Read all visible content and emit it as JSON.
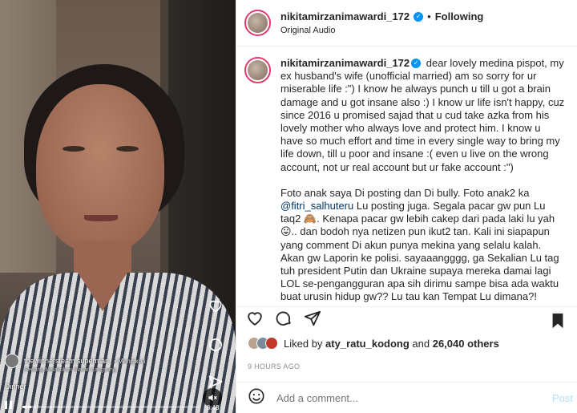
{
  "video": {
    "live_user": "thewinnersteam.superman",
    "live_follow": "• Mengikuti",
    "live_sub": "Sedang Melakukan Siaran Langsung",
    "caption": "Dinner",
    "timecode": "0:43",
    "progress_fraction": 0.05,
    "icons": [
      "heart-icon",
      "comment-icon",
      "share-icon",
      "mute-icon",
      "pause-icon"
    ]
  },
  "header": {
    "username": "nikitamirzanimawardi_172",
    "separator": "•",
    "follow_label": "Following",
    "subtitle": "Original Audio"
  },
  "caption": {
    "username": "nikitamirzanimawardi_172",
    "paragraph1": "dear lovely medina pispot, my ex husband's wife (unofficial married) am so sorry for ur miserable life :\") I know he always punch u till u got a brain damage and u got insane also :) I know ur life isn't happy, cuz since 2016 u promised sajad that u cud take azka from his lovely mother who always love and protect him. I know u have so much effort and time in every single way to bring my life down, till u poor and insane :( even u live on the wrong account, not ur real account but ur fake account :\")",
    "paragraph2_a": "Foto anak saya Di posting dan Di bully. Foto anak2 ka ",
    "mention": "@fitri_salhuteru",
    "paragraph2_b": " Lu posting juga. Segala pacar gw pun Lu taq2 🙈. Kenapa pacar gw lebih cakep dari pada laki lu yah 😛.. dan bodoh nya netizen pun ikut2 tan. Kali ini siapapun yang comment Di akun punya mekina yang selalu kalah. Akan gw Laporin ke polisi. sayaaangggg, ga Sekalian Lu tag tuh president Putin dan Ukraine supaya mereka damai lagi LOL se-pengangguran apa sih dirimu sampe bisa ada waktu buat urusin hidup gw?? Lu tau kan Tempat Lu dimana?! YASH tong SAMPAH!"
  },
  "likes": {
    "prefix": "Liked by ",
    "user": "aty_ratu_kodong",
    "middle": " and ",
    "count": "26,040 others"
  },
  "time": "9 HOURS AGO",
  "comment": {
    "placeholder": "Add a comment...",
    "post_label": "Post"
  },
  "colors": {
    "verified": "#0095f6",
    "story_ring": "#e03a6e",
    "post_disabled": "#b2dffc",
    "muted_text": "#8e8e8e"
  }
}
